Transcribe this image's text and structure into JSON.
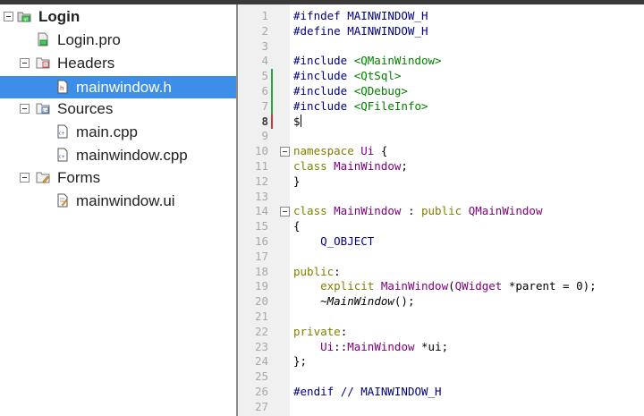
{
  "project_tree": {
    "project": "Login",
    "pro_file": "Login.pro",
    "headers_folder": "Headers",
    "header_file": "mainwindow.h",
    "sources_folder": "Sources",
    "source_main": "main.cpp",
    "source_mainwindow": "mainwindow.cpp",
    "forms_folder": "Forms",
    "form_file": "mainwindow.ui"
  },
  "editor": {
    "line_numbers": [
      "1",
      "2",
      "3",
      "4",
      "5",
      "6",
      "7",
      "8",
      "9",
      "10",
      "11",
      "12",
      "13",
      "14",
      "15",
      "16",
      "17",
      "18",
      "19",
      "20",
      "21",
      "22",
      "23",
      "24",
      "25",
      "26",
      "27"
    ],
    "current_line": "8",
    "code": {
      "l1": "#ifndef MAINWINDOW_H",
      "l2": "#define MAINWINDOW_H",
      "l4_pp": "#include ",
      "l4_hdr": "<QMainWindow>",
      "l5_pp": "#include ",
      "l5_hdr": "<QtSql>",
      "l6_pp": "#include ",
      "l6_hdr": "<QDebug>",
      "l7_pp": "#include ",
      "l7_hdr": "<QFileInfo>",
      "l8": "$",
      "l10_kw": "namespace ",
      "l10_id": "Ui",
      "l10_tail": " {",
      "l11_kw": "class ",
      "l11_id": "MainWindow",
      "l11_tail": ";",
      "l12": "}",
      "l14_kw": "class ",
      "l14_id": "MainWindow",
      "l14_mid": " : ",
      "l14_kw2": "public ",
      "l14_base": "QMainWindow",
      "l15": "{",
      "l16": "    Q_OBJECT",
      "l18_kw": "public",
      "l18_tail": ":",
      "l19_ind": "    ",
      "l19_kw": "explicit ",
      "l19_fn": "MainWindow",
      "l19_p1": "(",
      "l19_ty": "QWidget",
      "l19_rest": " *parent = 0);",
      "l20_ind": "    ",
      "l20_fn": "~MainWindow",
      "l20_rest": "();",
      "l22_kw": "private",
      "l22_tail": ":",
      "l23_ind": "    ",
      "l23_ns": "Ui",
      "l23_sep": "::",
      "l23_ty": "MainWindow",
      "l23_rest": " *ui;",
      "l24": "};",
      "l26_pp": "#endif ",
      "l26_cm": "// MAINWINDOW_H"
    }
  },
  "colors": {
    "selection": "#3d8ee8",
    "gutter": "#f0f0f0",
    "keyword": "#808000",
    "type": "#800080",
    "string": "#008000",
    "preprocessor": "#000080",
    "added_marker": "#2ea043",
    "modified_marker": "#d23a3a"
  }
}
